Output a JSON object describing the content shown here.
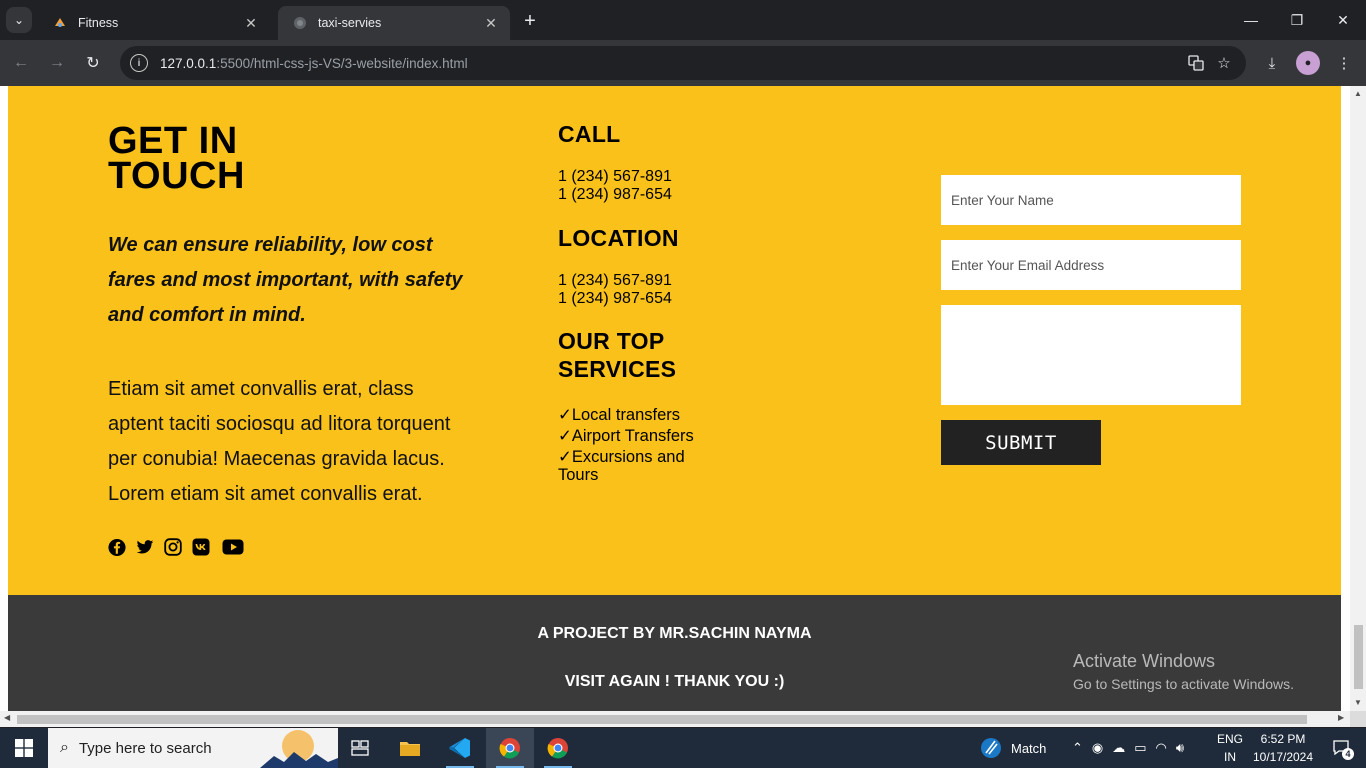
{
  "browser": {
    "tabs": [
      {
        "title": "Fitness",
        "active": false
      },
      {
        "title": "taxi-servies",
        "active": true
      }
    ],
    "url_host": "127.0.0.1",
    "url_path": ":5500/html-css-js-VS/3-website/index.html"
  },
  "contact": {
    "heading_line1": "GET IN",
    "heading_line2": "TOUCH",
    "tagline": "We can ensure reliability, low cost fares and most important, with safety and comfort in mind.",
    "paragraph": "Etiam sit amet convallis erat, class aptent taciti sociosqu ad litora torquent per conubia! Maecenas gravida lacus. Lorem etiam sit amet convallis erat.",
    "social_icons": [
      "facebook-icon",
      "twitter-icon",
      "instagram-icon",
      "vk-icon",
      "youtube-icon"
    ],
    "call_heading": "CALL",
    "call_phones": [
      "1 (234) 567-891",
      "1 (234) 987-654"
    ],
    "location_heading": "LOCATION",
    "location_lines": [
      "1 (234) 567-891",
      "1 (234) 987-654"
    ],
    "services_heading_line1": "OUR TOP",
    "services_heading_line2": "SERVICES",
    "services": [
      "✓Local transfers",
      "✓Airport Transfers",
      "✓Excursions and",
      "Tours"
    ],
    "form": {
      "name_placeholder": "Enter Your Name",
      "email_placeholder": "Enter Your Email Address",
      "message_placeholder": "",
      "submit_label": "SUBMIT"
    }
  },
  "footer": {
    "line1": "A PROJECT BY MR.SACHIN NAYMA",
    "line2": "VISIT AGAIN ! THANK YOU :)"
  },
  "watermark": {
    "title": "Activate Windows",
    "subtitle": "Go to Settings to activate Windows."
  },
  "taskbar": {
    "search_placeholder": "Type here to search",
    "weather_label": "Match",
    "lang_line1": "ENG",
    "lang_line2": "IN",
    "time": "6:52 PM",
    "date": "10/17/2024",
    "notification_count": "4"
  },
  "colors": {
    "accent_yellow": "#f9c11a",
    "footer_bg": "#3b3a3a",
    "button_bg": "#222222"
  }
}
